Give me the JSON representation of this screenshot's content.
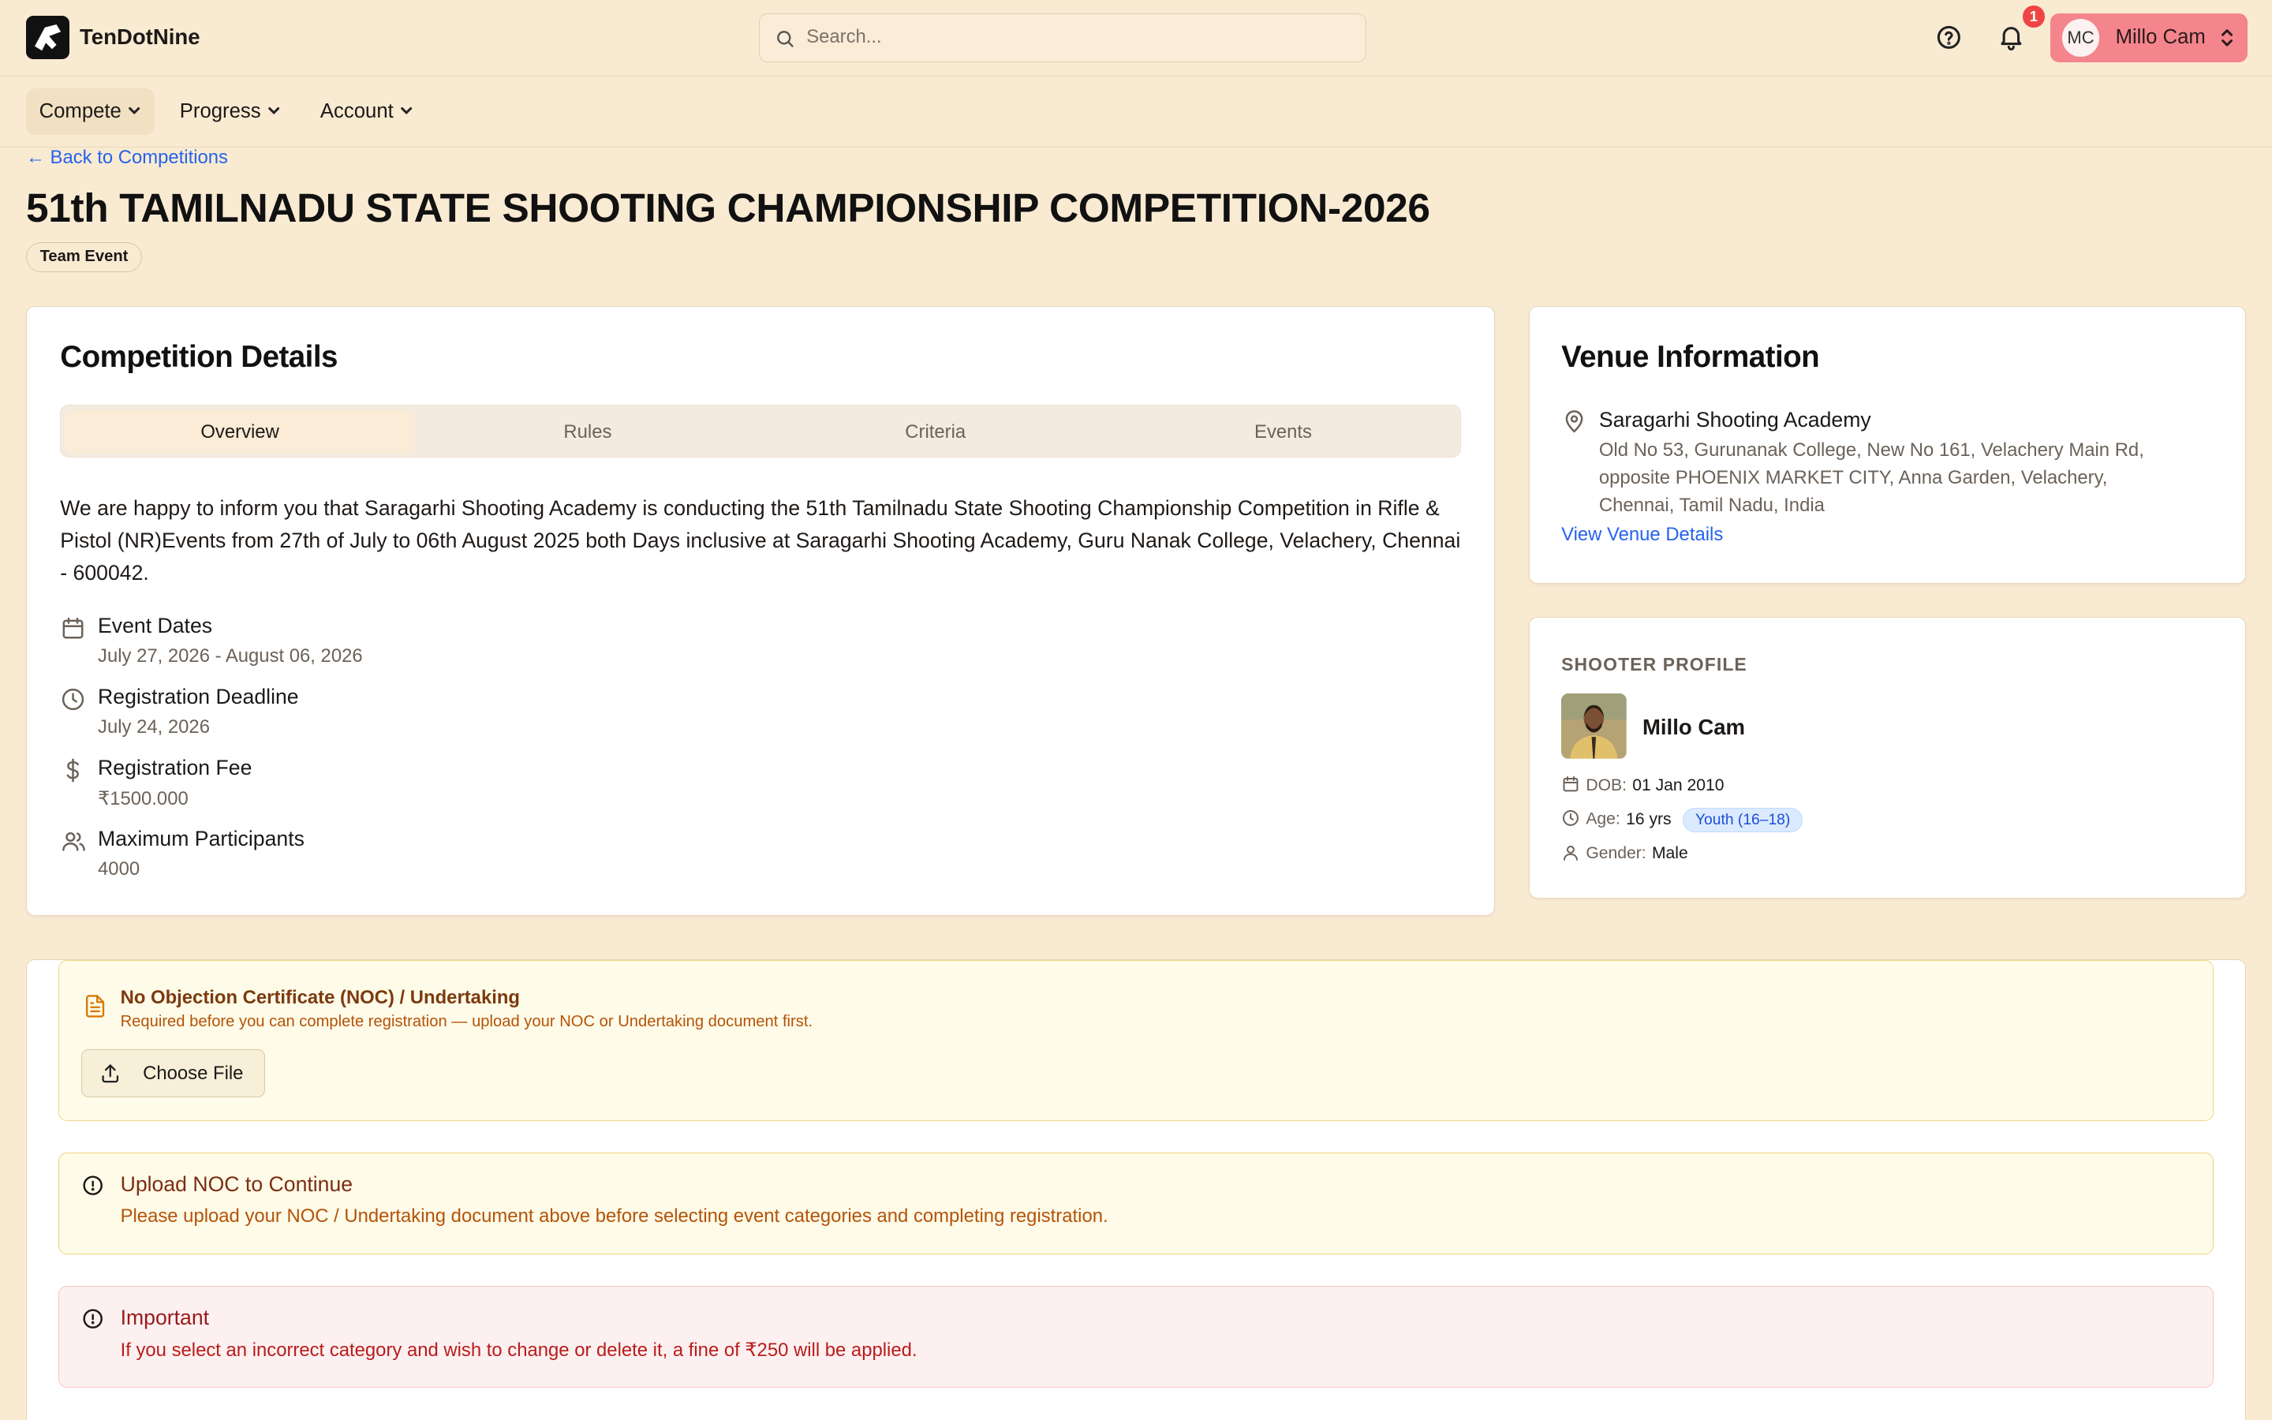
{
  "app": {
    "brand": "TenDotNine"
  },
  "search": {
    "placeholder": "Search..."
  },
  "header": {
    "notification_count": "1",
    "user_initials": "MC",
    "user_name": "Millo Cam"
  },
  "nav": [
    {
      "label": "Compete"
    },
    {
      "label": "Progress"
    },
    {
      "label": "Account"
    }
  ],
  "page": {
    "back_label": "← Back to Competitions",
    "title": "51th TAMILNADU STATE SHOOTING CHAMPIONSHIP COMPETITION-2026",
    "badge": "Team Event"
  },
  "details": {
    "title": "Competition Details",
    "tabs": [
      {
        "label": "Overview"
      },
      {
        "label": "Rules"
      },
      {
        "label": "Criteria"
      },
      {
        "label": "Events"
      }
    ],
    "description": "We are happy to inform you that Saragarhi Shooting Academy is conducting the 51th Tamilnadu State Shooting Championship Competition in Rifle & Pistol (NR)Events from 27th of July to 06th August 2025 both Days inclusive at Saragarhi Shooting Academy, Guru Nanak College, Velachery, Chennai - 600042.",
    "items": [
      {
        "label": "Event Dates",
        "value": "July 27, 2026 - August 06, 2026",
        "icon": "calendar-icon"
      },
      {
        "label": "Registration Deadline",
        "value": "July 24, 2026",
        "icon": "clock-icon"
      },
      {
        "label": "Registration Fee",
        "value": "₹1500.000",
        "icon": "dollar-icon"
      },
      {
        "label": "Maximum Participants",
        "value": "4000",
        "icon": "users-icon"
      }
    ]
  },
  "venue": {
    "title": "Venue Information",
    "name": "Saragarhi Shooting Academy",
    "address": "Old No 53, Gurunanak College, New No 161, Velachery Main Rd, opposite PHOENIX MARKET CITY, Anna Garden, Velachery, Chennai, Tamil Nadu, India",
    "link_label": "View Venue Details"
  },
  "shooter": {
    "section_label": "SHOOTER PROFILE",
    "name": "Millo Cam",
    "dob_label": "DOB:",
    "dob": "01 Jan 2010",
    "age_label": "Age:",
    "age": "16 yrs",
    "age_group": "Youth (16–18)",
    "gender_label": "Gender:",
    "gender": "Male"
  },
  "noc": {
    "title": "No Objection Certificate (NOC) / Undertaking",
    "subtitle": "Required before you can complete registration — upload your NOC or Undertaking document first.",
    "button_label": "Choose File"
  },
  "alerts": [
    {
      "title": "Upload NOC to Continue",
      "message": "Please upload your NOC / Undertaking document above before selecting event categories and completing registration."
    },
    {
      "title": "Important",
      "message": "If you select an incorrect category and wish to change or delete it, a fine of ₹250 will be applied."
    }
  ],
  "colors": {
    "background": "#f9ead2",
    "accent": "#2563eb",
    "user_button": "#f4858d",
    "badge": "#ef4444"
  }
}
